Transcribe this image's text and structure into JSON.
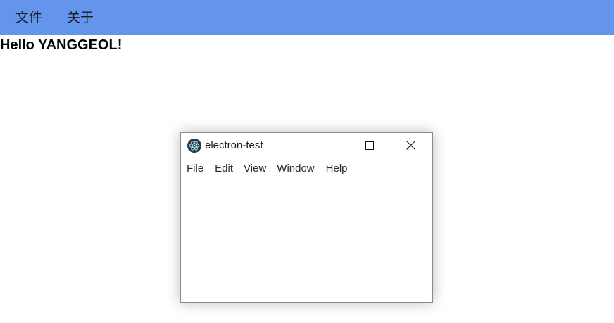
{
  "host": {
    "menubar": {
      "background": "#6495ED",
      "items": [
        {
          "label": "文件"
        },
        {
          "label": "关于"
        }
      ]
    },
    "greeting": "Hello YANGGEOL!"
  },
  "window": {
    "title": "electron-test",
    "app_icon": "electron-atom-icon",
    "controls": [
      "minimize-icon",
      "maximize-icon",
      "close-icon"
    ],
    "menu": [
      {
        "label": "File"
      },
      {
        "label": "Edit"
      },
      {
        "label": "View"
      },
      {
        "label": "Window"
      },
      {
        "label": "Help"
      }
    ]
  }
}
